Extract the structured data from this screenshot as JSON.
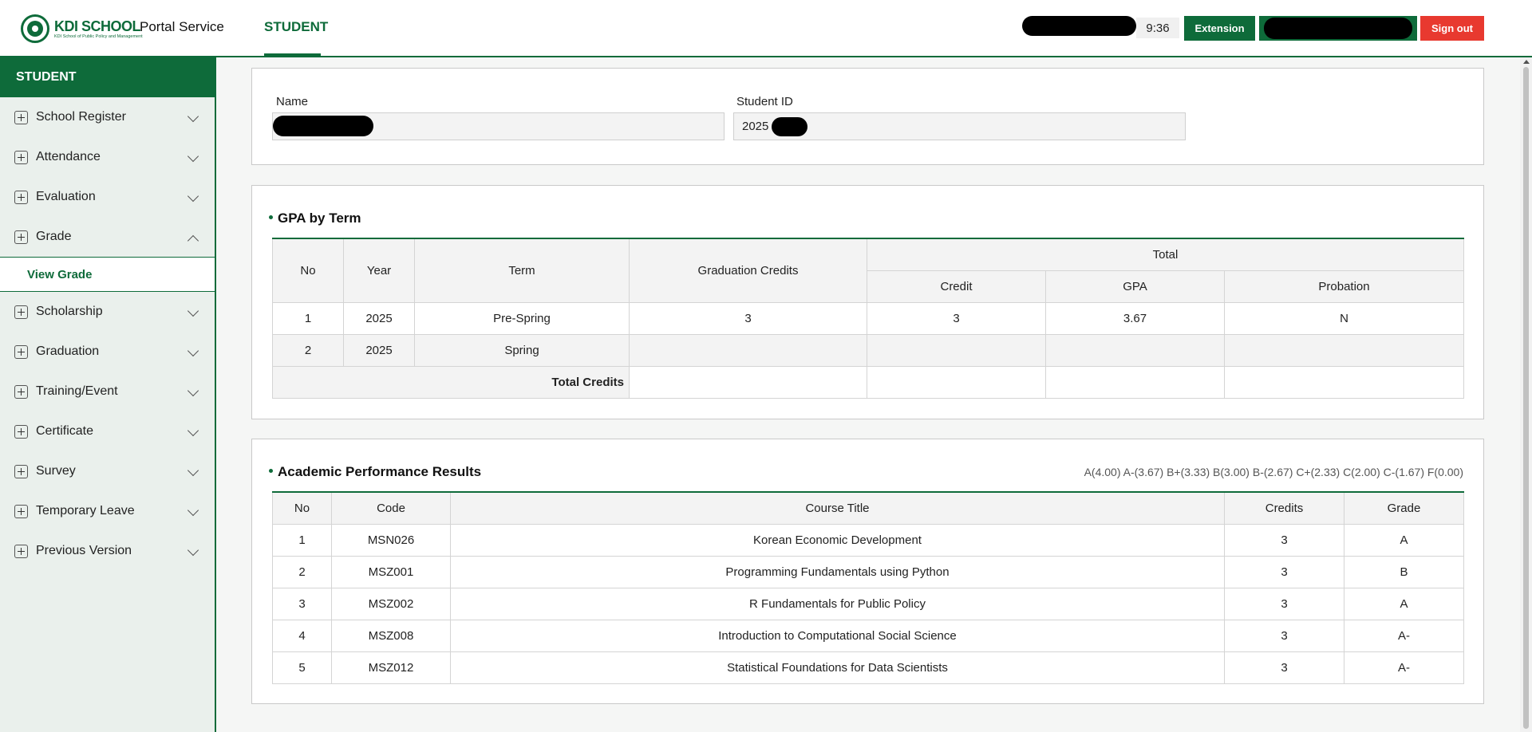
{
  "header": {
    "logo": {
      "name": "KDI SCHOOL",
      "subtitle": "KDI School of Public Policy and Management"
    },
    "portal_title": "Portal Service",
    "active_tab": "STUDENT",
    "clock": "9:36",
    "extension_label": "Extension",
    "signout_label": "Sign out"
  },
  "sidebar": {
    "title": "STUDENT",
    "items": [
      {
        "label": "School Register"
      },
      {
        "label": "Attendance"
      },
      {
        "label": "Evaluation"
      },
      {
        "label": "Grade"
      },
      {
        "label": "Scholarship"
      },
      {
        "label": "Graduation"
      },
      {
        "label": "Training/Event"
      },
      {
        "label": "Certificate"
      },
      {
        "label": "Survey"
      },
      {
        "label": "Temporary Leave"
      },
      {
        "label": "Previous Version"
      }
    ],
    "submenu_label": "View Grade"
  },
  "student_info": {
    "name_label": "Name",
    "id_label": "Student ID",
    "id_prefix": "2025"
  },
  "gpa_by_term": {
    "title": "GPA by Term",
    "headers": {
      "no": "No",
      "year": "Year",
      "term": "Term",
      "graduation_credits": "Graduation Credits",
      "total": "Total",
      "credit": "Credit",
      "gpa": "GPA",
      "probation": "Probation"
    },
    "rows": [
      {
        "no": "1",
        "year": "2025",
        "term": "Pre-Spring",
        "graduation_credits": "3",
        "credit": "3",
        "gpa": "3.67",
        "probation": "N"
      },
      {
        "no": "2",
        "year": "2025",
        "term": "Spring",
        "graduation_credits": "",
        "credit": "",
        "gpa": "",
        "probation": ""
      }
    ],
    "total_credits_label": "Total Credits"
  },
  "academic_results": {
    "title": "Academic Performance Results",
    "legend": "A(4.00) A-(3.67) B+(3.33) B(3.00) B-(2.67) C+(2.33) C(2.00) C-(1.67) F(0.00)",
    "headers": {
      "no": "No",
      "code": "Code",
      "title": "Course Title",
      "credits": "Credits",
      "grade": "Grade"
    },
    "rows": [
      {
        "no": "1",
        "code": "MSN026",
        "title": "Korean Economic Development",
        "credits": "3",
        "grade": "A"
      },
      {
        "no": "2",
        "code": "MSZ001",
        "title": "Programming Fundamentals using Python",
        "credits": "3",
        "grade": "B"
      },
      {
        "no": "3",
        "code": "MSZ002",
        "title": "R Fundamentals for Public Policy",
        "credits": "3",
        "grade": "A"
      },
      {
        "no": "4",
        "code": "MSZ008",
        "title": "Introduction to Computational Social Science",
        "credits": "3",
        "grade": "A-"
      },
      {
        "no": "5",
        "code": "MSZ012",
        "title": "Statistical Foundations for Data Scientists",
        "credits": "3",
        "grade": "A-"
      }
    ]
  },
  "colors": {
    "brand_green": "#0e6b3a",
    "signout_red": "#e8392f"
  }
}
